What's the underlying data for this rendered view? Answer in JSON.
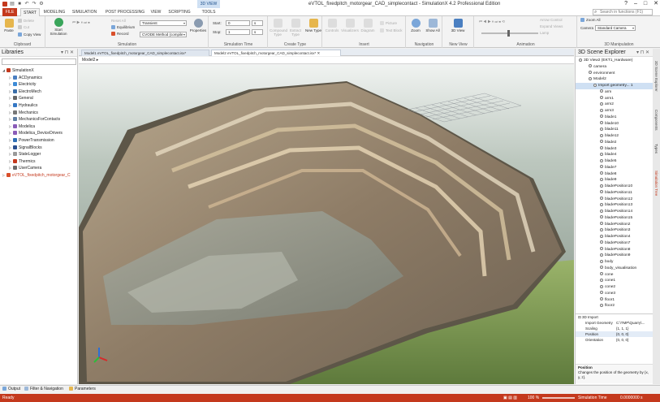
{
  "titlebar": {
    "context_tab": "3D VIEW",
    "app_title": "eVTOL_fixedpitch_motorgear_CAD_simplecontact - SimulationX 4.2 Professional Edition"
  },
  "ribbon_tabs": [
    "FILE",
    "START",
    "MODELING",
    "SIMULATION",
    "POST PROCESSING",
    "VIEW",
    "SCRIPTING",
    "TOOLS"
  ],
  "search": {
    "placeholder": "Search in functions (F1)"
  },
  "ribbon": {
    "clipboard": {
      "paste": "Paste",
      "cut": "Cut",
      "copy_view": "Copy View",
      "label": "Clipboard",
      "delete_label": "Delete"
    },
    "simulation": {
      "start": "Start Simulation",
      "mode": "Transient",
      "reset_all": "Reset All",
      "equilibrium": "Equilibrium",
      "record": "Record",
      "method": "CVODE Method (compile",
      "properties": "Properties",
      "label": "Simulation"
    },
    "simtime": {
      "start_label": "Start:",
      "start_val": "0",
      "start_unit": "s",
      "stop_label": "Stop:",
      "stop_val": "1",
      "stop_unit": "s",
      "label": "Simulation Time"
    },
    "createtype": {
      "compound": "Compound Type",
      "extract": "Extract Type",
      "new_type": "New Type",
      "label": "Create Type"
    },
    "insert": {
      "controls": "Controls",
      "visualizers": "Visualizers",
      "diagram": "Diagram",
      "picture": "Picture",
      "textblock": "Text Block",
      "label": "Insert"
    },
    "navigation": {
      "zoom": "Zoom",
      "showall": "Show All",
      "label": "Navigation"
    },
    "newview": {
      "view3d": "3D View",
      "label": "New View"
    },
    "animation": {
      "label": "Animation"
    },
    "manip": {
      "zoom_all": "Zoom All",
      "camera_label": "Camera",
      "camera_val": "Standard Camera",
      "arrow_control": "Arrow Control",
      "expand": "Expand Views",
      "lamp": "Lamp",
      "label": "3D Manipulation"
    }
  },
  "libraries": {
    "title": "Libraries",
    "items": [
      {
        "label": "SimulationX",
        "color": "#c4391d",
        "expand": "◢",
        "indent": 0
      },
      {
        "label": "ACDynamics",
        "color": "#4a7fc1",
        "expand": "▷",
        "indent": 1
      },
      {
        "label": "Electricity",
        "color": "#3d8bd6",
        "expand": "▷",
        "indent": 1
      },
      {
        "label": "ElectroMech",
        "color": "#3a6ea8",
        "expand": "▷",
        "indent": 1
      },
      {
        "label": "General",
        "color": "#666666",
        "expand": "▷",
        "indent": 1
      },
      {
        "label": "Hydraulics",
        "color": "#3477c4",
        "expand": "▷",
        "indent": 1
      },
      {
        "label": "Mechanics",
        "color": "#777777",
        "expand": "▷",
        "indent": 1
      },
      {
        "label": "MechanicsForContacts",
        "color": "#5e7ea3",
        "expand": "▷",
        "indent": 1
      },
      {
        "label": "Modelica",
        "color": "#8a5cb8",
        "expand": "▷",
        "indent": 1
      },
      {
        "label": "Modelica_DeviceDrivers",
        "color": "#8a5cb8",
        "expand": "▷",
        "indent": 1
      },
      {
        "label": "PowerTransmission",
        "color": "#2f6fb5",
        "expand": "▷",
        "indent": 1
      },
      {
        "label": "SignalBlocks",
        "color": "#2a4f8f",
        "expand": "▷",
        "indent": 1
      },
      {
        "label": "StateLogger",
        "color": "#999999",
        "expand": "▷",
        "indent": 1
      },
      {
        "label": "Thermics",
        "color": "#c4391d",
        "expand": "▷",
        "indent": 1
      },
      {
        "label": "UserCamera",
        "color": "#6a6a6a",
        "expand": "▷",
        "indent": 1
      },
      {
        "label": "eVTOL_fixedpitch_motorgear_C",
        "color": "#d94f2b",
        "expand": "▷",
        "indent": 0,
        "highlight": true
      }
    ]
  },
  "doc_tabs": {
    "tab1": "Model1 eVTOL_fixedpitch_motorgear_CAD_simplecontact.isx*",
    "tab2": "Model2 eVTOL_fixedpitch_motorgear_CAD_simplecontact.isx*",
    "close": "✕"
  },
  "breadcrumb": "Model2",
  "scene": {
    "title": "3D Scene Explorer",
    "items": [
      "3D View2 (EKT1_Hardware)",
      "camera",
      "environment",
      "Model2",
      "Import geometry... 1",
      "arm",
      "arm1",
      "arm2",
      "arm3",
      "blade1",
      "blade10",
      "blade11",
      "blade12",
      "blade2",
      "blade3",
      "blade4",
      "blade5",
      "blade7",
      "blade8",
      "blade9",
      "bladePosition10",
      "bladePosition11",
      "bladePosition12",
      "bladePosition13",
      "bladePosition14",
      "bladePosition15",
      "bladePosition2",
      "bladePosition3",
      "bladePosition4",
      "bladePosition7",
      "bladePosition8",
      "bladePosition9",
      "body",
      "body_visualisation",
      "cone",
      "cone1",
      "cone2",
      "cone3",
      "floor1",
      "floor2"
    ],
    "properties_header": "3D Import",
    "properties": [
      {
        "name": "Import Geometry",
        "value": "C:\\TMP\\Quarry\\..."
      },
      {
        "name": "Scaling",
        "value": "{1, 1, 1}"
      },
      {
        "name": "Position",
        "value": "{0, 0, 0}"
      },
      {
        "name": "Orientation",
        "value": "{0, 0, 0}"
      }
    ],
    "help_title": "Position",
    "help_text": "Changes the position of the geometry by {x, y, z}."
  },
  "side_tabs": [
    "3D Scene Explorer",
    "Components",
    "Types",
    "Simulation Tree"
  ],
  "bottom_tabs": [
    "Output",
    "Filter & Navigation",
    "Parameters"
  ],
  "status": {
    "ready": "Ready",
    "zoom": "100 %",
    "sim_time_label": "Simulation Time",
    "sim_time_value": "0.0000000 s"
  }
}
